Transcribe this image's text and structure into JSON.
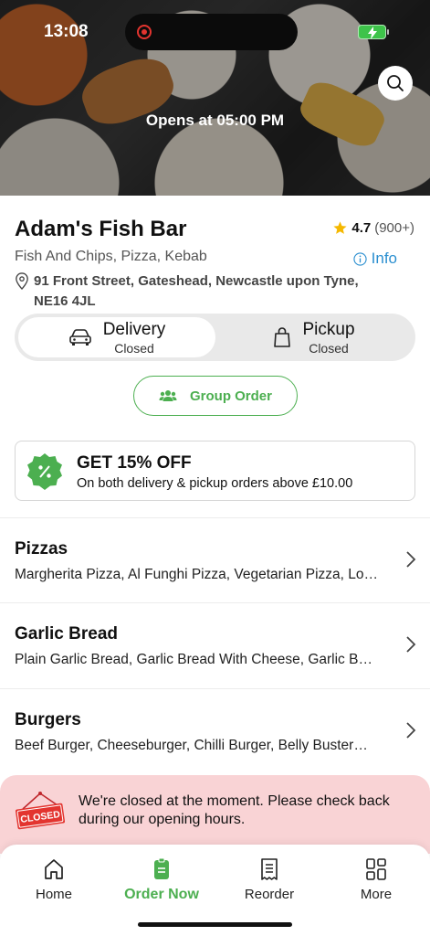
{
  "status_bar": {
    "time": "13:08"
  },
  "hero": {
    "opens_text": "Opens at 05:00 PM",
    "search_icon": "search-icon"
  },
  "restaurant": {
    "name": "Adam's Fish Bar",
    "rating": "4.7",
    "rating_count": "(900+)",
    "cuisines": "Fish And Chips, Pizza, Kebab",
    "info_label": "Info",
    "address": "91 Front Street, Gateshead, Newcastle upon Tyne, NE16 4JL"
  },
  "order_mode": {
    "delivery": {
      "label": "Delivery",
      "status": "Closed",
      "selected": true
    },
    "pickup": {
      "label": "Pickup",
      "status": "Closed",
      "selected": false
    }
  },
  "group_order": {
    "label": "Group Order"
  },
  "promo": {
    "title": "GET 15% OFF",
    "subtitle": "On both delivery & pickup orders above £10.00"
  },
  "categories": [
    {
      "name": "Pizzas",
      "items": "Margherita Pizza, Al Funghi Pizza, Vegetarian Pizza, Lo…"
    },
    {
      "name": "Garlic Bread",
      "items": "Plain Garlic Bread, Garlic Bread With Cheese, Garlic B…"
    },
    {
      "name": "Burgers",
      "items": "Beef Burger, Cheeseburger, Chilli Burger, Belly Buster…"
    }
  ],
  "closed_banner": {
    "sign_text": "CLOSED",
    "message": "We're closed at the moment. Please check back during our opening hours."
  },
  "tabbar": {
    "items": [
      {
        "label": "Home",
        "icon": "home-icon",
        "active": false
      },
      {
        "label": "Order Now",
        "icon": "order-icon",
        "active": true
      },
      {
        "label": "Reorder",
        "icon": "receipt-icon",
        "active": false
      },
      {
        "label": "More",
        "icon": "grid-icon",
        "active": false
      }
    ]
  },
  "colors": {
    "accent": "#4caf50",
    "link": "#2b8fd0",
    "banner_bg": "#f9d3d5",
    "closed_red": "#e3342f"
  }
}
